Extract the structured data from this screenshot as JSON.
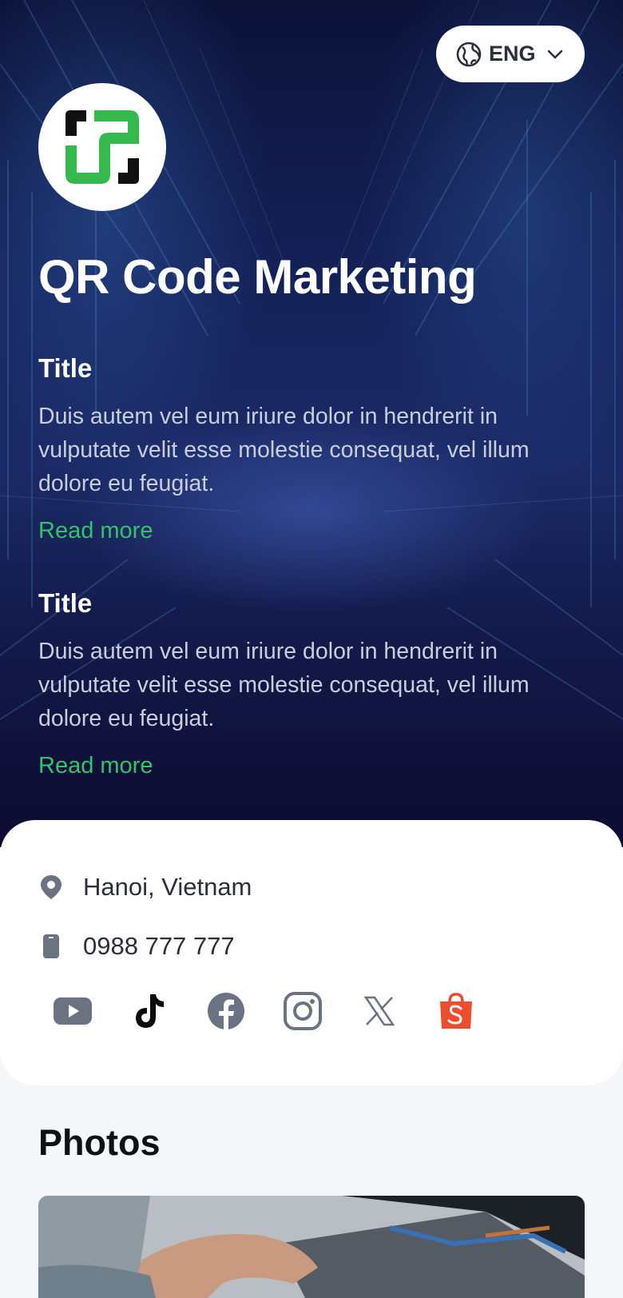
{
  "header": {
    "language": "ENG",
    "language_icon": "globe-icon",
    "brand_title": "QR Code Marketing"
  },
  "posts": [
    {
      "title": "Title",
      "body": "Duis autem vel eum iriure dolor in hendrerit in vulputate velit esse molestie consequat, vel illum dolore eu feugiat.",
      "link": "Read more"
    },
    {
      "title": "Title",
      "body": "Duis autem vel eum iriure dolor in hendrerit in vulputate velit esse molestie consequat, vel illum dolore eu feugiat.",
      "link": "Read more"
    }
  ],
  "contact": {
    "location": "Hanoi, Vietnam",
    "phone": "0988 777 777"
  },
  "socials": [
    "youtube-icon",
    "tiktok-icon",
    "facebook-icon",
    "instagram-icon",
    "x-icon",
    "shopee-icon"
  ],
  "photos": {
    "heading": "Photos"
  },
  "colors": {
    "accent": "#35c36a",
    "hero_bg": "#131a4a",
    "text_dark": "#2b2f3a",
    "shopee": "#ee4d2d"
  }
}
